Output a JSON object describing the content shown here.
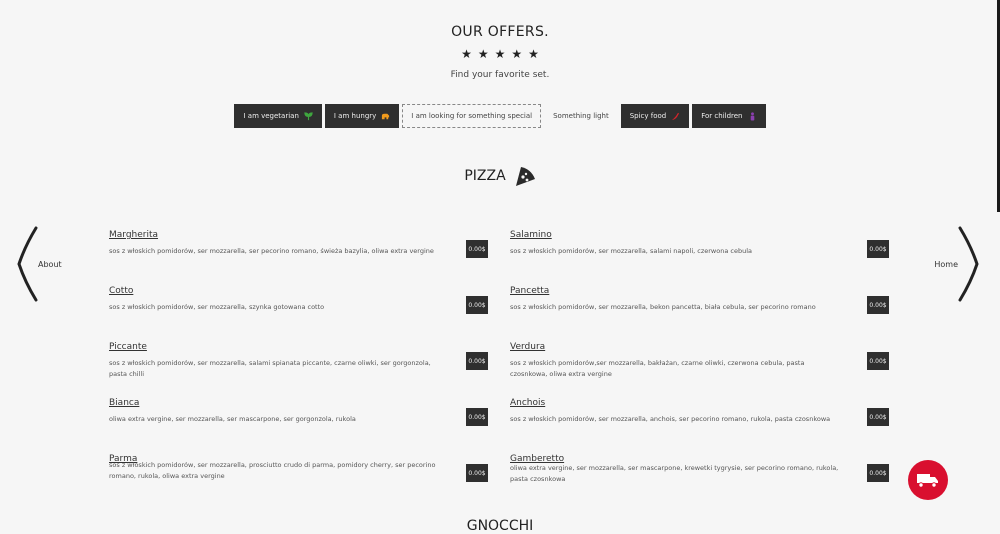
{
  "header": {
    "title": "OUR OFFERS.",
    "stars": [
      "★",
      "★",
      "★",
      "★",
      "★"
    ],
    "subtitle": "Find your favorite set."
  },
  "filters": [
    {
      "label": "I am vegetarian",
      "icon": "leaf-icon",
      "icon_color": "#3fa63f",
      "style": "dark"
    },
    {
      "label": "I am hungry",
      "icon": "bear-icon",
      "icon_color": "#f09a1c",
      "style": "dark"
    },
    {
      "label": "I am looking for something special",
      "icon": "",
      "icon_color": "",
      "style": "light"
    },
    {
      "label": "Something light",
      "icon": "",
      "icon_color": "",
      "style": "plain"
    },
    {
      "label": "Spicy food",
      "icon": "chili-icon",
      "icon_color": "#d6242a",
      "style": "dark"
    },
    {
      "label": "For children",
      "icon": "child-icon",
      "icon_color": "#8b3fb0",
      "style": "dark"
    }
  ],
  "section": {
    "title": "PIZZA",
    "icon": "pizza-slice-icon"
  },
  "nav": {
    "left": "About",
    "right": "Home"
  },
  "menu": [
    [
      {
        "name": "Margherita",
        "desc": "sos z włoskich pomidorów, ser mozzarella, ser pecorino romano, świeża bazylia, oliwa extra vergine",
        "price": "0.00$"
      },
      {
        "name": "Salamino",
        "desc": "sos z włoskich pomidorów, ser mozzarella, salami napoli, czerwona cebula",
        "price": "0.00$"
      }
    ],
    [
      {
        "name": "Cotto",
        "desc": "sos z włoskich pomidorów, ser mozzarella, szynka gotowana cotto",
        "price": "0.00$"
      },
      {
        "name": "Pancetta",
        "desc": "sos z włoskich pomidorów, ser mozzarella, bekon pancetta, biała cebula, ser pecorino romano",
        "price": "0.00$"
      }
    ],
    [
      {
        "name": "Piccante",
        "desc": "sos z włoskich pomidorów, ser mozzarella, salami spianata piccante, czarne oliwki, ser gorgonzola, pasta chilli",
        "price": "0.00$"
      },
      {
        "name": "Verdura",
        "desc": "sos z włoskich pomidorów,ser mozzarella, bakłażan, czarne oliwki, czerwona cebula, pasta czosnkowa, oliwa extra vergine",
        "price": "0.00$"
      }
    ],
    [
      {
        "name": "Bianca",
        "desc": "oliwa extra vergine, ser mozzarella, ser mascarpone, ser gorgonzola, rukola",
        "price": "0.00$"
      },
      {
        "name": "Anchois",
        "desc": "sos z włoskich pomidorów, ser mozzarella, anchois, ser pecorino romano, rukola, pasta czosnkowa",
        "price": "0.00$"
      }
    ],
    [
      {
        "name": "Parma",
        "desc": "sos z włoskich pomidorów, ser mozzarella, prosciutto crudo di parma, pomidory cherry, ser pecorino romano, rukola, oliwa extra vergine",
        "price": "0.00$"
      },
      {
        "name": "Gamberetto",
        "desc": "oliwa extra vergine, ser mozzarella, ser mascarpone, krewetki tygrysie, ser pecorino romano, rukola, pasta czosnkowa",
        "price": "0.00$"
      }
    ]
  ],
  "next_section": {
    "title": "GNOCCHI"
  },
  "delivery": {
    "icon": "delivery-truck-icon",
    "color": "#d90f2f"
  }
}
